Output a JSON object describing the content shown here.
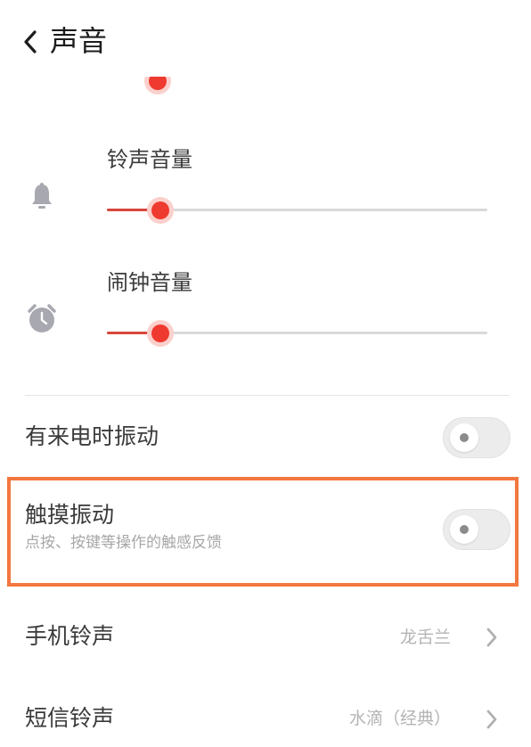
{
  "header": {
    "title": "声音"
  },
  "ringtone_volume": {
    "label": "铃声音量",
    "level_percent": 14
  },
  "alarm_volume": {
    "label": "闹钟音量",
    "level_percent": 14
  },
  "vibrate_on_call": {
    "label": "有来电时振动",
    "state": "off"
  },
  "touch_vibration": {
    "label": "触摸振动",
    "description": "点按、按键等操作的触感反馈",
    "state": "off"
  },
  "phone_ringtone": {
    "label": "手机铃声",
    "value": "龙舌兰"
  },
  "sms_ringtone": {
    "label": "短信铃声",
    "value": "水滴（经典）"
  },
  "colors": {
    "accent": "#ef3a2f",
    "highlight_border": "#f3773f"
  },
  "icons": {
    "back": "chevron-left-icon",
    "ringtone": "bell-icon",
    "alarm": "alarm-clock-icon"
  }
}
